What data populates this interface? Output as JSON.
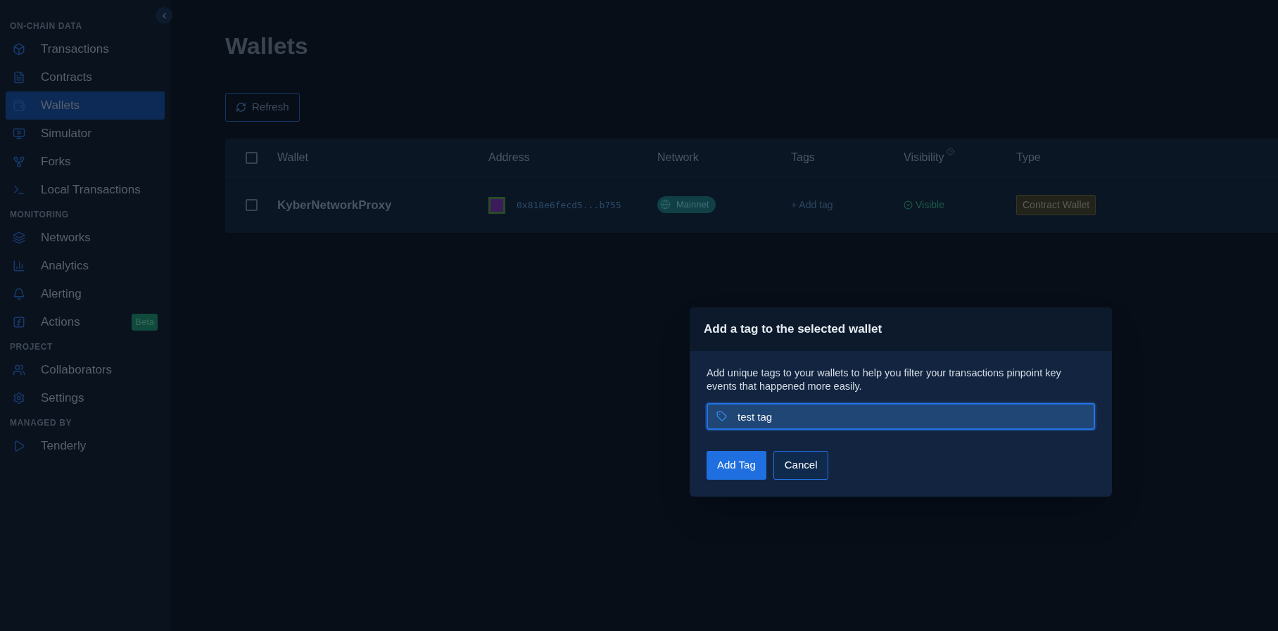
{
  "sidebar": {
    "sections": [
      {
        "title": "ON-CHAIN DATA",
        "items": [
          {
            "label": "Transactions",
            "selected": false
          },
          {
            "label": "Contracts",
            "selected": false
          },
          {
            "label": "Wallets",
            "selected": true
          },
          {
            "label": "Simulator",
            "selected": false
          },
          {
            "label": "Forks",
            "selected": false
          },
          {
            "label": "Local Transactions",
            "selected": false
          }
        ]
      },
      {
        "title": "MONITORING",
        "items": [
          {
            "label": "Networks",
            "selected": false
          },
          {
            "label": "Analytics",
            "selected": false
          },
          {
            "label": "Alerting",
            "selected": false
          },
          {
            "label": "Actions",
            "selected": false,
            "badge": "Beta"
          }
        ]
      },
      {
        "title": "PROJECT",
        "items": [
          {
            "label": "Collaborators",
            "selected": false
          },
          {
            "label": "Settings",
            "selected": false
          }
        ]
      },
      {
        "title": "MANAGED BY",
        "items": [
          {
            "label": "Tenderly",
            "selected": false
          }
        ]
      }
    ]
  },
  "page": {
    "title": "Wallets",
    "refresh_button": "Refresh"
  },
  "table": {
    "select_all_checked": false,
    "columns": [
      "Wallet",
      "Address",
      "Network",
      "Tags",
      "Visibility",
      "Type"
    ],
    "rows": [
      {
        "checked": false,
        "wallet": "KyberNetworkProxy",
        "address": "0x818e6fecd5...b755",
        "network": "Mainnet",
        "add_tag": "+ Add tag",
        "visibility": "Visible",
        "type": "Contract Wallet"
      }
    ]
  },
  "dialog": {
    "title": "Add a tag to the selected wallet",
    "description": "Add unique tags to your wallets to help you filter your transactions pinpoint key events that happened more easily.",
    "input": {
      "value": "test tag"
    },
    "buttons": [
      {
        "label": "Add Tag",
        "kind": "primary"
      },
      {
        "label": "Cancel",
        "kind": "secondary"
      }
    ]
  }
}
